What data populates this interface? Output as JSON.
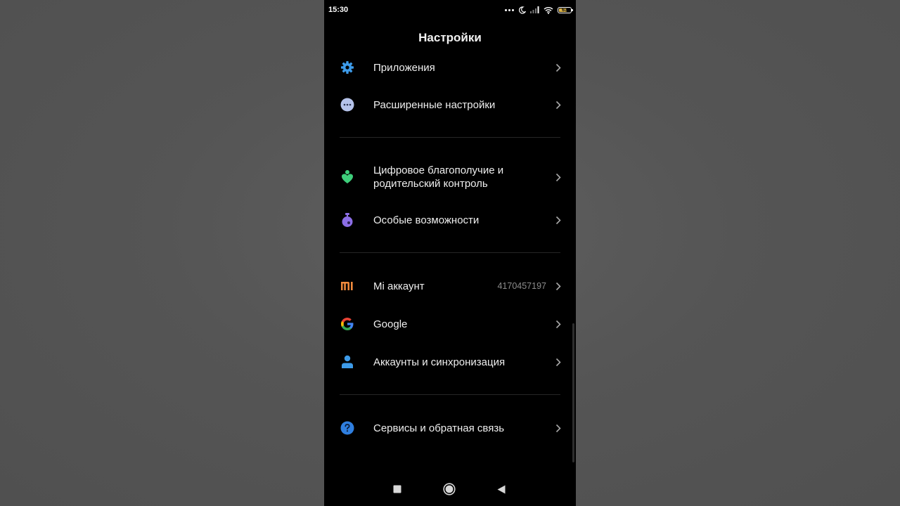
{
  "status_bar": {
    "time": "15:30",
    "battery_level": "63"
  },
  "header": {
    "title": "Настройки"
  },
  "items": [
    {
      "label": "Приложения",
      "icon": "gear-icon",
      "color": "#3d9be9"
    },
    {
      "label": "Расширенные настройки",
      "icon": "more-dots-icon",
      "color": "#b5c3ea"
    },
    {
      "label": "Цифровое благополучие и родительский контроль",
      "icon": "wellbeing-heart-icon",
      "color": "#3ecf7b"
    },
    {
      "label": "Особые возможности",
      "icon": "accessibility-icon",
      "color": "#8c6ee6"
    },
    {
      "label": "Mi аккаунт",
      "value": "4170457197",
      "icon": "mi-logo-icon",
      "color": "#f08a3c"
    },
    {
      "label": "Google",
      "icon": "google-g-icon",
      "color": "#4285f4"
    },
    {
      "label": "Аккаунты и синхронизация",
      "icon": "person-icon",
      "color": "#3d9be9"
    },
    {
      "label": "Сервисы и обратная связь",
      "icon": "help-question-icon",
      "color": "#2f7fe0"
    }
  ],
  "nav": {
    "buttons": [
      "recents-square-icon",
      "home-circle-icon",
      "back-triangle-icon"
    ]
  }
}
